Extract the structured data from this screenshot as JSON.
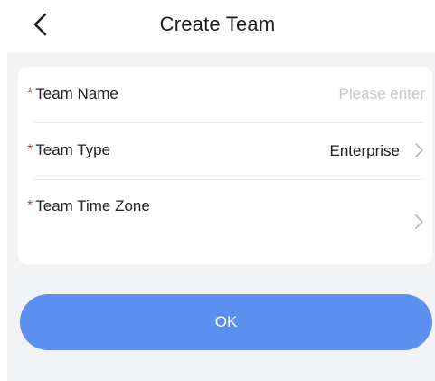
{
  "header": {
    "back_icon": "chevron-left-icon",
    "title": "Create Team"
  },
  "form": {
    "required_marker": "*",
    "team_name": {
      "label": "Team Name",
      "placeholder": "Please enter",
      "value": ""
    },
    "team_type": {
      "label": "Team Type",
      "value": "Enterprise",
      "icon": "chevron-right-icon"
    },
    "team_time_zone": {
      "label": "Team Time Zone",
      "value": "",
      "icon": "chevron-right-icon"
    }
  },
  "actions": {
    "ok_label": "OK"
  },
  "colors": {
    "accent": "#5b8ff0",
    "required": "#e0332c",
    "background": "#f2f3f5",
    "card": "#ffffff",
    "placeholder": "#c7c7c7"
  }
}
